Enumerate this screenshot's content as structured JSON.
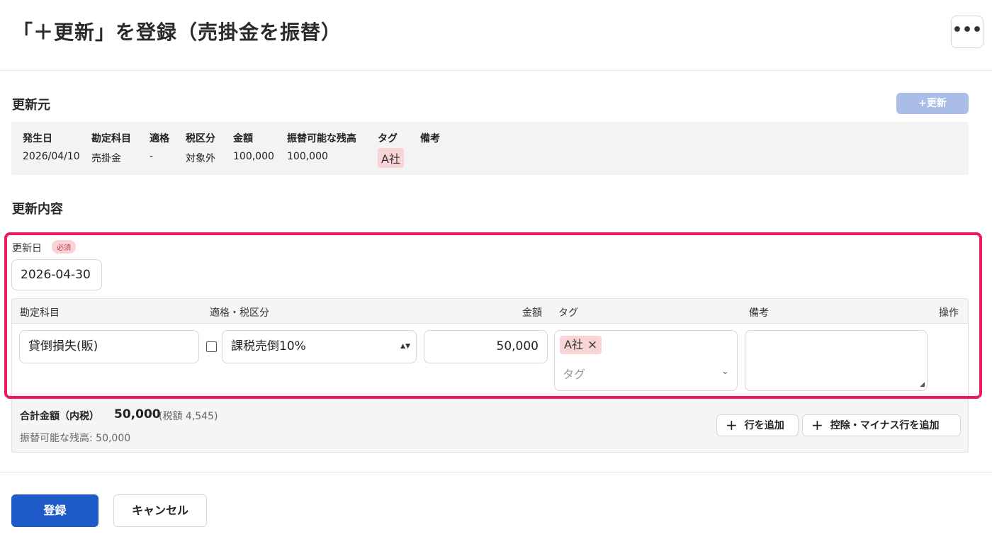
{
  "header": {
    "title": "「＋更新」を登録（売掛金を振替）",
    "more_label": "•••"
  },
  "source": {
    "section_title": "更新元",
    "plus_update_label": "+更新",
    "columns": [
      "発生日",
      "勘定科目",
      "適格",
      "税区分",
      "金額",
      "振替可能な残高",
      "タグ",
      "備考"
    ],
    "row": {
      "date": "2026/04/10",
      "account": "売掛金",
      "qualified": "-",
      "tax_category": "対象外",
      "amount": "100,000",
      "transferable_balance": "100,000",
      "tag": "A社",
      "note": ""
    }
  },
  "content": {
    "section_title": "更新内容",
    "date_label": "更新日",
    "required_badge": "必須",
    "date_value": "2026-04-30",
    "columns": {
      "account": "勘定科目",
      "qualified_tax": "適格・税区分",
      "amount": "金額",
      "tag": "タグ",
      "note": "備考",
      "actions": "操作"
    },
    "line": {
      "account": "貸倒損失(販)",
      "qualified_checked": false,
      "tax_category": "課税売倒10%",
      "amount": "50,000",
      "tag": "A社",
      "tag_remove": "×",
      "tag_placeholder": "タグ",
      "note": ""
    },
    "total_label": "合計金額（内税）",
    "total_amount": "50,000",
    "tax_note": "(税額 4,545)",
    "remaining": "振替可能な残高: 50,000",
    "add_row_label": "行を追加",
    "add_minus_row_label": "控除・マイナス行を追加"
  },
  "footer": {
    "submit_label": "登録",
    "cancel_label": "キャンセル"
  },
  "colors": {
    "primary": "#1f5ac9",
    "highlight_border": "#f0175e",
    "tag_bg": "#f8d4d6",
    "disabled_button": "#a9bde8"
  }
}
